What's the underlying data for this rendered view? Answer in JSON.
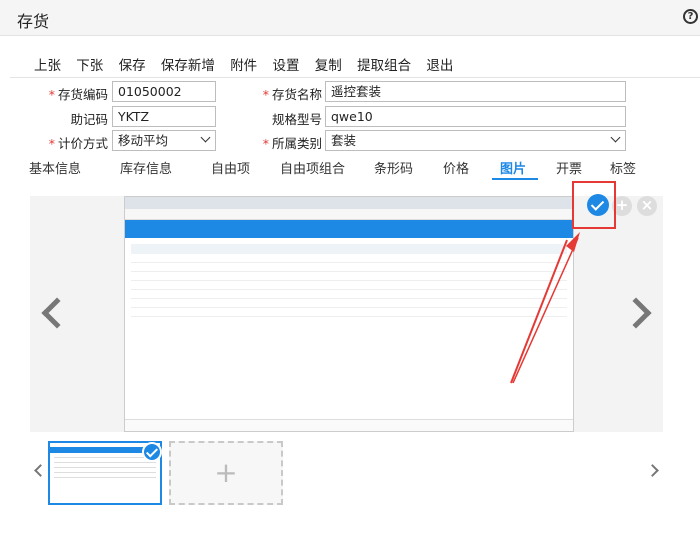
{
  "window": {
    "title": "存货"
  },
  "toolbar": {
    "items": [
      "上张",
      "下张",
      "保存",
      "保存新增",
      "附件",
      "设置",
      "复制",
      "提取组合",
      "退出"
    ]
  },
  "form": {
    "code_label": "存货编码",
    "code_value": "01050002",
    "name_label": "存货名称",
    "name_value": "遥控套装",
    "mnemonic_label": "助记码",
    "mnemonic_value": "YKTZ",
    "spec_label": "规格型号",
    "spec_value": "qwe10",
    "costing_label": "计价方式",
    "costing_value": "移动平均",
    "category_label": "所属类别",
    "category_value": "套装"
  },
  "tabs": [
    {
      "label": "基本信息"
    },
    {
      "label": "库存信息"
    },
    {
      "label": "自由项"
    },
    {
      "label": "自由项组合"
    },
    {
      "label": "条形码"
    },
    {
      "label": "价格"
    },
    {
      "label": "图片",
      "active": true
    },
    {
      "label": "开票"
    },
    {
      "label": "标签"
    }
  ],
  "colors": {
    "accent": "#1e88e5",
    "highlight": "#e53935"
  }
}
